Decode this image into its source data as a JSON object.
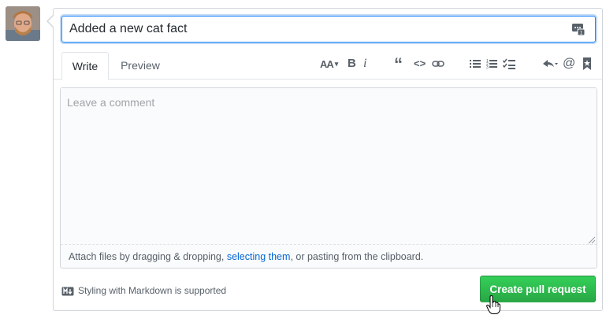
{
  "title_field": {
    "value": "Added a new cat fact"
  },
  "tabs": [
    {
      "label": "Write",
      "selected": true
    },
    {
      "label": "Preview",
      "selected": false
    }
  ],
  "toolbar": {
    "header_label": "AA",
    "bold_label": "B",
    "italic_label": "i",
    "quote_label": "“",
    "code_label": "<>",
    "mention_label": "@",
    "icons": [
      "header-icon",
      "bold-icon",
      "italic-icon",
      "quote-icon",
      "code-icon",
      "link-icon",
      "unordered-list-icon",
      "ordered-list-icon",
      "task-list-icon",
      "reply-icon",
      "mention-icon",
      "bookmark-icon"
    ]
  },
  "comment": {
    "placeholder": "Leave a comment",
    "attach_prefix": "Attach files by dragging & dropping, ",
    "attach_link": "selecting them",
    "attach_suffix": ", or pasting from the clipboard."
  },
  "footer": {
    "markdown_note": "Styling with Markdown is supported",
    "create_button_label": "Create pull request"
  },
  "colors": {
    "accent_blue": "#2188ff",
    "link_blue": "#0366d6",
    "button_green": "#28a745"
  }
}
